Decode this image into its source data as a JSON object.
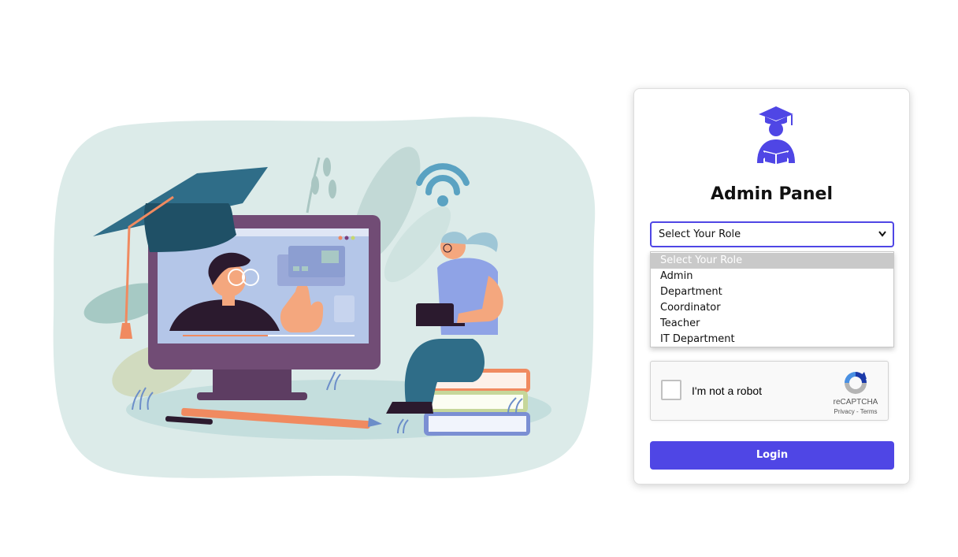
{
  "panel": {
    "title": "Admin Panel",
    "icon": "graduate-reading-icon"
  },
  "role_select": {
    "selected": "Select Your Role",
    "options": [
      "Select Your Role",
      "Admin",
      "Department",
      "Coordinator",
      "Teacher",
      "IT Department"
    ]
  },
  "recaptcha": {
    "label": "I'm not a robot",
    "brand": "reCAPTCHA",
    "links": "Privacy - Terms"
  },
  "login": {
    "label": "Login"
  },
  "colors": {
    "accent": "#4f46e5",
    "blob": "#dcebe9",
    "monitor": "#714c75",
    "cap": "#2f6d88"
  }
}
